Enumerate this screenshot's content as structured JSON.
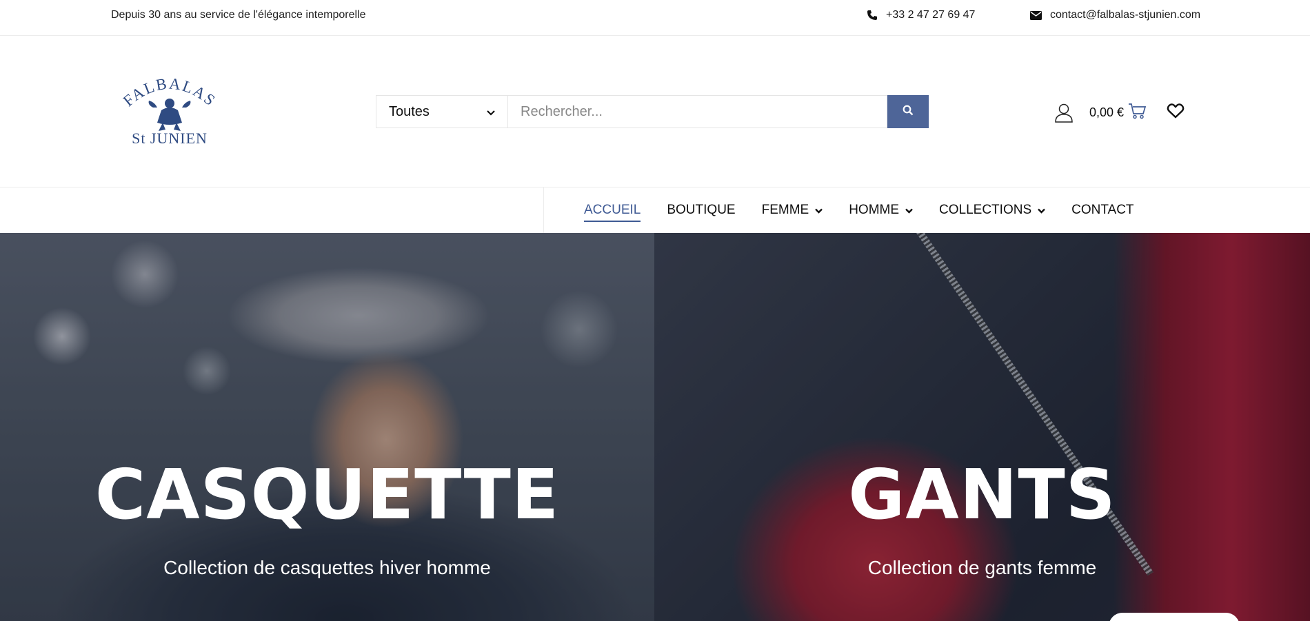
{
  "topbar": {
    "tagline": "Depuis 30 ans au service de l'élégance intemporelle",
    "phone": "+33 2 47 27 69 47",
    "email": "contact@falbalas-stjunien.com"
  },
  "logo": {
    "line1": "FALBALAS",
    "line2": "St JUNIEN"
  },
  "search": {
    "category": "Toutes",
    "placeholder": "Rechercher..."
  },
  "cart": {
    "total": "0,00 €"
  },
  "nav": {
    "items": [
      {
        "label": "ACCUEIL",
        "active": true
      },
      {
        "label": "BOUTIQUE"
      },
      {
        "label": "FEMME",
        "dropdown": true
      },
      {
        "label": "HOMME",
        "dropdown": true
      },
      {
        "label": "COLLECTIONS",
        "dropdown": true
      },
      {
        "label": "CONTACT"
      }
    ]
  },
  "hero": {
    "left": {
      "title": "CASQUETTE",
      "subtitle": "Collection de casquettes hiver homme"
    },
    "right": {
      "title": "GANTS",
      "subtitle": "Collection de gants femme"
    }
  },
  "colors": {
    "accent": "#4e6598",
    "nav_active": "#3f5a94"
  }
}
